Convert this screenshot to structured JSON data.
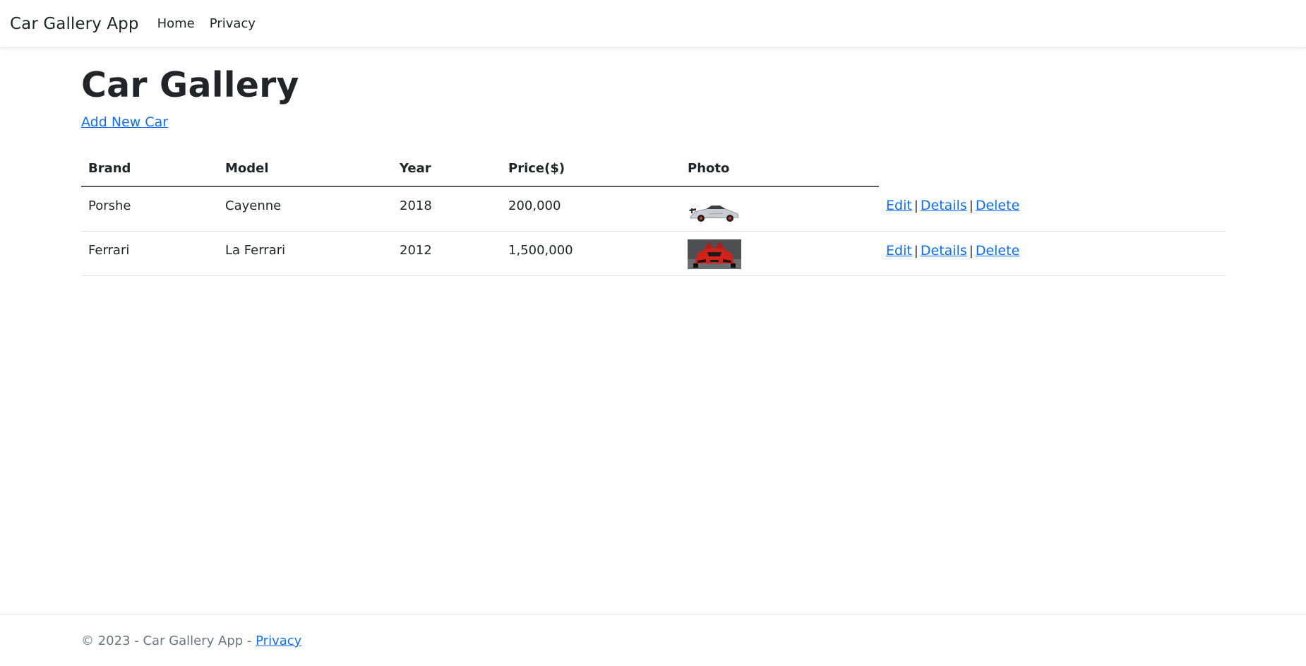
{
  "navbar": {
    "brand": "Car Gallery App",
    "links": [
      {
        "label": "Home"
      },
      {
        "label": "Privacy"
      }
    ]
  },
  "main": {
    "title": "Car Gallery",
    "add_link": "Add New Car",
    "table": {
      "headers": [
        "Brand",
        "Model",
        "Year",
        "Price($)",
        "Photo"
      ],
      "rows": [
        {
          "brand": "Porshe",
          "model": "Cayenne",
          "year": "2018",
          "price": "200,000",
          "photo": "silver sports car photo"
        },
        {
          "brand": "Ferrari",
          "model": "La Ferrari",
          "year": "2012",
          "price": "1,500,000",
          "photo": "red supercar photo"
        }
      ],
      "actions": {
        "edit": "Edit",
        "details": "Details",
        "delete": "Delete",
        "separator": "|"
      }
    }
  },
  "footer": {
    "text": "© 2023 - Car Gallery App - ",
    "link": "Privacy"
  },
  "colors": {
    "link": "#0d6efd",
    "text": "#212529",
    "muted": "#6c757d"
  }
}
